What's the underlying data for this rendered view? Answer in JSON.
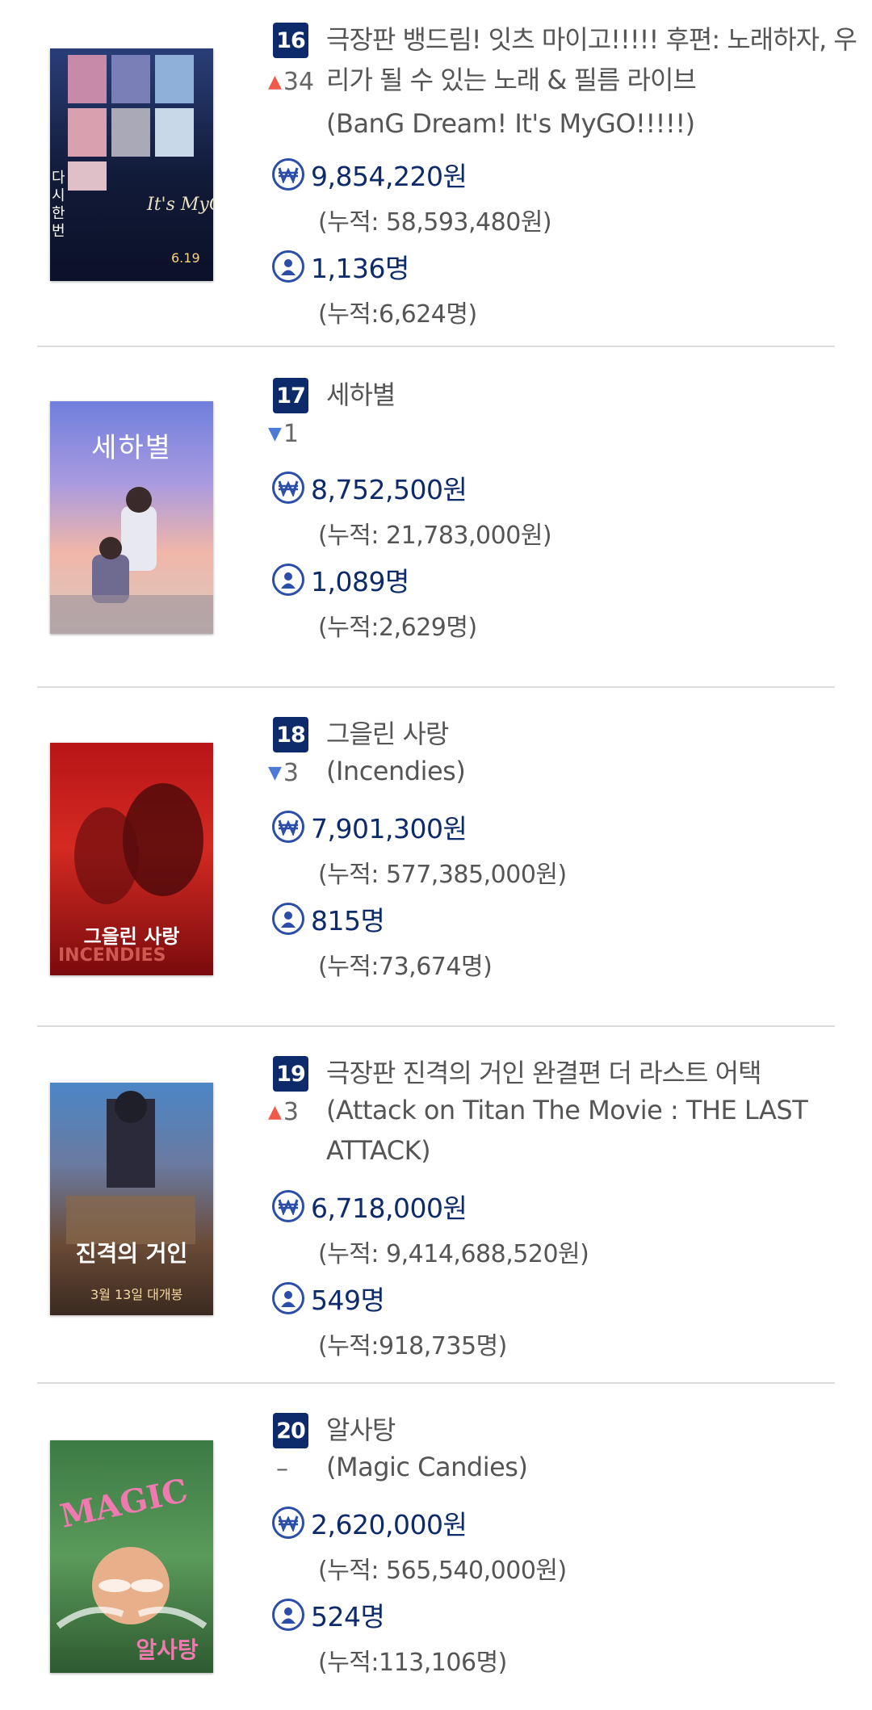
{
  "movies": [
    {
      "rank": "16",
      "title": "극장판 뱅드림! 잇츠 마이고!!!!! 후편: 노래하자, 우리가 될 수 있는 노래 & 필름 라이브",
      "change_dir": "up",
      "change_value": "34",
      "original_title": "(BanG Dream! It's MyGO!!!!!)",
      "revenue": "9,854,220원",
      "revenue_cum": "(누적: 58,593,480원)",
      "audience": "1,136명",
      "audience_cum": "(누적:6,624명)",
      "poster_text": "다시 한번",
      "poster_colors": [
        "#0f1630",
        "#1a2a55"
      ]
    },
    {
      "rank": "17",
      "title": "세하별",
      "change_dir": "down",
      "change_value": "1",
      "original_title": "",
      "revenue": "8,752,500원",
      "revenue_cum": "(누적: 21,783,000원)",
      "audience": "1,089명",
      "audience_cum": "(누적:2,629명)",
      "poster_text": "세하별",
      "poster_colors": [
        "#7d8be0",
        "#f2b39a"
      ]
    },
    {
      "rank": "18",
      "title": "그을린 사랑",
      "change_dir": "down",
      "change_value": "3",
      "original_title": "(Incendies)",
      "revenue": "7,901,300원",
      "revenue_cum": "(누적: 577,385,000원)",
      "audience": "815명",
      "audience_cum": "(누적:73,674명)",
      "poster_text": "그을린 사랑",
      "poster_colors": [
        "#c8191c",
        "#5a0a0a"
      ]
    },
    {
      "rank": "19",
      "title": "극장판 진격의 거인 완결편 더 라스트 어택",
      "change_dir": "up",
      "change_value": "3",
      "original_title": "(Attack on Titan The Movie : THE LAST ATTACK)",
      "revenue": "6,718,000원",
      "revenue_cum": "(누적: 9,414,688,520원)",
      "audience": "549명",
      "audience_cum": "(누적:918,735명)",
      "poster_text": "진격의 거인",
      "poster_colors": [
        "#3b6fb0",
        "#5a3a28"
      ]
    },
    {
      "rank": "20",
      "title": "알사탕",
      "change_dir": "none",
      "change_value": "",
      "original_title": "(Magic Candies)",
      "revenue": "2,620,000원",
      "revenue_cum": "(누적: 565,540,000원)",
      "audience": "524명",
      "audience_cum": "(누적:113,106명)",
      "poster_text": "알사탕",
      "poster_colors": [
        "#2f6b3a",
        "#7aa85a"
      ]
    }
  ],
  "icons": {
    "revenue": "won-coin-icon",
    "audience": "person-icon"
  },
  "colors": {
    "badge": "#0d2a6b",
    "value_text": "#0d2a6b",
    "icon": "#2b4ea8",
    "up_arrow": "#f05a4a",
    "down_arrow": "#4b7bd6"
  }
}
